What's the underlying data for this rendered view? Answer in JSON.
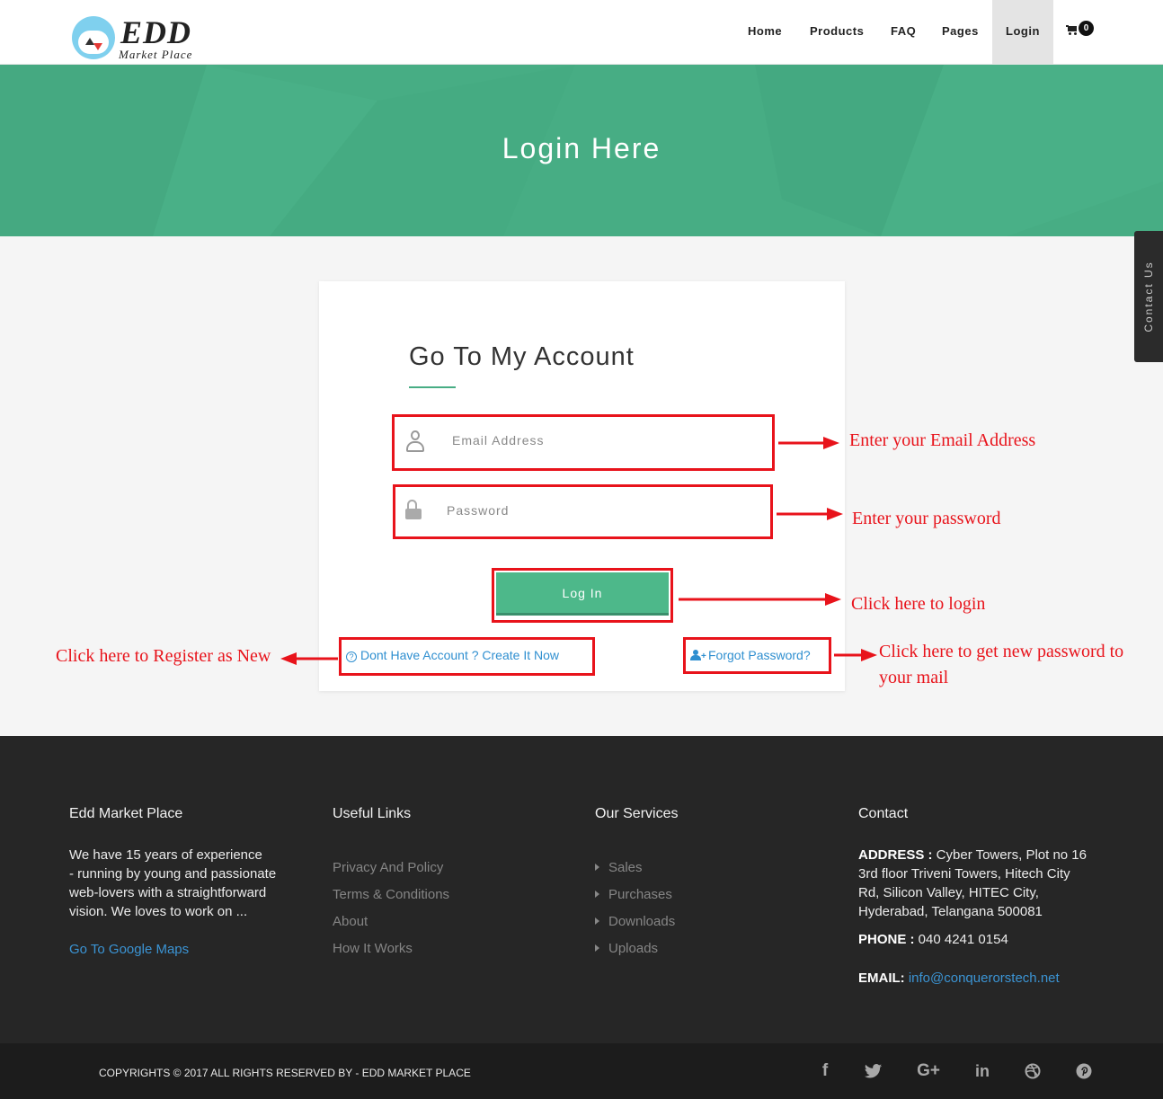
{
  "brand": {
    "name": "EDD",
    "tagline": "Market Place"
  },
  "nav": {
    "home": "Home",
    "products": "Products",
    "faq": "FAQ",
    "pages": "Pages",
    "login": "Login",
    "cart_count": "0"
  },
  "banner": {
    "title": "Login Here"
  },
  "contact_tab": "Contact Us",
  "form": {
    "title": "Go To My Account",
    "email_placeholder": "Email Address",
    "password_placeholder": "Password",
    "login_button": "Log In",
    "register_link": "Dont Have Account ? Create It Now",
    "forgot_link": "Forgot Password?"
  },
  "annotations": {
    "email": "Enter your Email Address",
    "password": "Enter your password",
    "login": "Click here to login",
    "register": "Click here to Register as New",
    "forgot_line1": "Click here to get new password to",
    "forgot_line2": "your mail"
  },
  "footer": {
    "about": {
      "heading": "Edd Market Place",
      "lines": [
        "We have 15 years of experience",
        "- running by young and passionate",
        "web-lovers with a straightforward",
        "vision. We loves to work on ..."
      ],
      "maps_link": "Go To Google Maps"
    },
    "links": {
      "heading": "Useful Links",
      "items": [
        "Privacy And Policy",
        "Terms & Conditions",
        "About",
        "How It Works"
      ]
    },
    "services": {
      "heading": "Our Services",
      "items": [
        "Sales",
        "Purchases",
        "Downloads",
        "Uploads"
      ]
    },
    "contact": {
      "heading": "Contact",
      "address_label": "ADDRESS :",
      "address_lines": [
        " Cyber Towers, Plot no 16",
        "3rd floor Triveni Towers, Hitech City",
        "Rd, Silicon Valley, HITEC City,",
        "Hyderabad, Telangana 500081"
      ],
      "phone_label": "PHONE :",
      "phone": " 040 4241 0154",
      "email_label": "EMAIL:",
      "email": " info@conquerorstech.net"
    },
    "copyright": "COPYRIGHTS © 2017 ALL RIGHTS RESERVED BY - EDD MARKET PLACE",
    "social": [
      "f",
      "t",
      "G+",
      "in",
      "dribbble",
      "p"
    ]
  },
  "colors": {
    "accent": "#47ad84",
    "annotation": "#e8131b",
    "link": "#2f8fd0",
    "footer_bg": "#262626"
  }
}
